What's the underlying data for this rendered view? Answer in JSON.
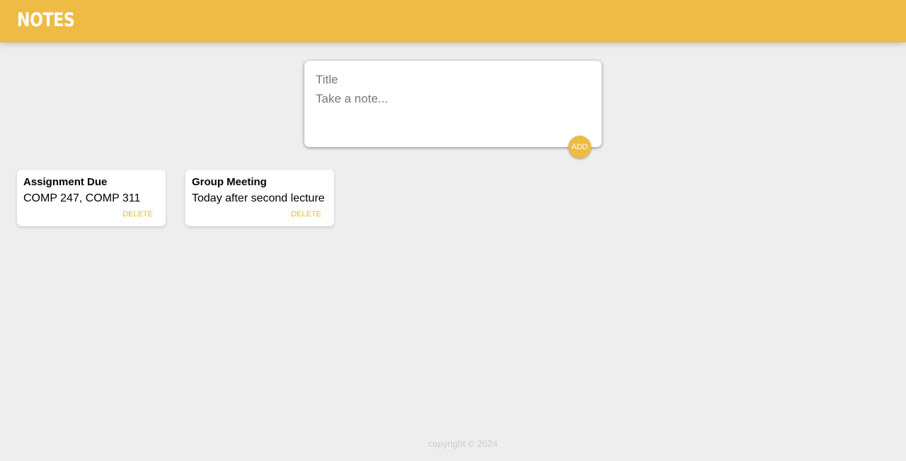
{
  "header": {
    "title": "NOTES"
  },
  "create_area": {
    "title_placeholder": "Title",
    "content_placeholder": "Take a note...",
    "add_label": "ADD"
  },
  "notes": [
    {
      "title": "Assignment Due",
      "content": "COMP 247, COMP 311",
      "delete_label": "DELETE"
    },
    {
      "title": "Group Meeting",
      "content": "Today after second lecture",
      "delete_label": "DELETE"
    }
  ],
  "footer": {
    "copyright": "copyright © 2024"
  },
  "colors": {
    "accent": "#eebb44",
    "background": "#eeeeee",
    "delete_text": "#f5ba13"
  }
}
